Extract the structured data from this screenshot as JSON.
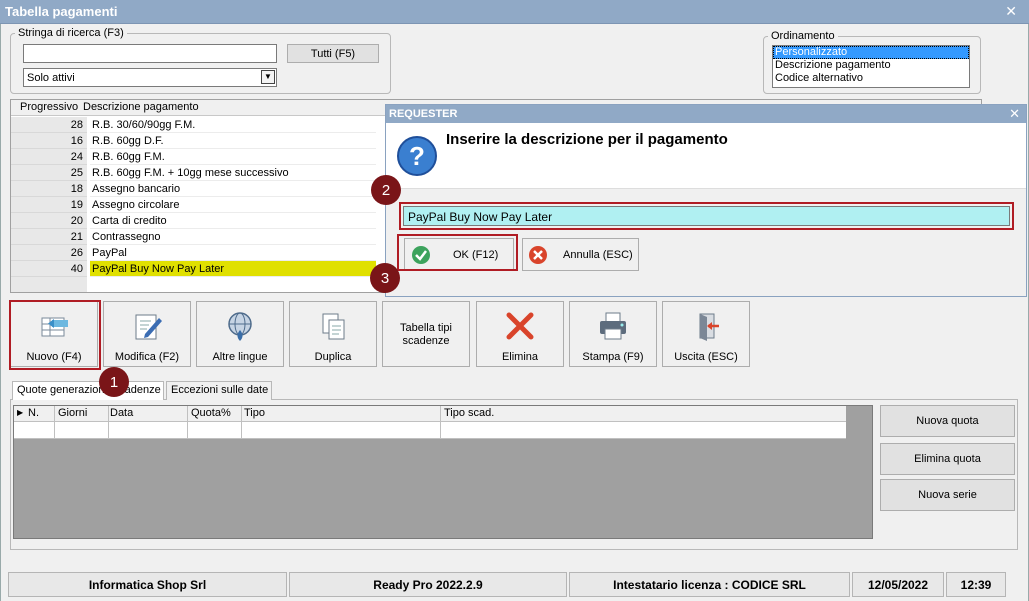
{
  "window": {
    "title": "Tabella pagamenti",
    "close": "✕"
  },
  "search": {
    "legend": "Stringa di ricerca (F3)",
    "value": "",
    "all_button": "Tutti (F5)",
    "filter": "Solo attivi"
  },
  "ordering": {
    "legend": "Ordinamento",
    "options": [
      "Personalizzato",
      "Descrizione pagamento",
      "Codice alternativo"
    ]
  },
  "grid": {
    "headers": [
      "Progressivo",
      "Descrizione pagamento"
    ],
    "rows": [
      {
        "num": "28",
        "desc": "R.B. 30/60/90gg F.M."
      },
      {
        "num": "16",
        "desc": "R.B. 60gg D.F."
      },
      {
        "num": "24",
        "desc": "R.B. 60gg F.M."
      },
      {
        "num": "25",
        "desc": "R.B. 60gg F.M. + 10gg mese successivo"
      },
      {
        "num": "18",
        "desc": "Assegno bancario"
      },
      {
        "num": "19",
        "desc": "Assegno circolare"
      },
      {
        "num": "20",
        "desc": "Carta di credito"
      },
      {
        "num": "21",
        "desc": "Contrassegno"
      },
      {
        "num": "26",
        "desc": "PayPal"
      },
      {
        "num": "40",
        "desc": "PayPal Buy Now Pay Later"
      }
    ]
  },
  "toolbar": {
    "new": "Nuovo (F4)",
    "edit": "Modifica (F2)",
    "languages": "Altre lingue",
    "duplicate": "Duplica",
    "due_types": "Tabella tipi scadenze",
    "delete": "Elimina",
    "print": "Stampa (F9)",
    "exit": "Uscita (ESC)"
  },
  "tabs": [
    "Quote generazione scadenze",
    "Eccezioni sulle date"
  ],
  "quotes": {
    "headers": [
      "N.",
      "Giorni",
      "Data",
      "Quota%",
      "Tipo",
      "Tipo scad."
    ],
    "buttons": [
      "Nuova quota",
      "Elimina quota",
      "Nuova serie"
    ]
  },
  "status": {
    "company": "Informatica Shop Srl",
    "version": "Ready Pro 2022.2.9",
    "license": "Intestatario licenza : CODICE SRL",
    "date": "12/05/2022",
    "time": "12:39"
  },
  "dialog": {
    "title": "REQUESTER",
    "close": "✕",
    "message": "Inserire la descrizione per il pagamento",
    "input_value": "PayPal Buy Now Pay Later",
    "ok": "OK (F12)",
    "cancel": "Annulla (ESC)"
  },
  "badges": [
    "1",
    "2",
    "3"
  ],
  "colors": {
    "highlight": "#b01c24",
    "badge": "#7a1518",
    "selected_row": "#e0e000",
    "input_bg": "#b0f0f2",
    "titlebar": "#90a9c6"
  }
}
